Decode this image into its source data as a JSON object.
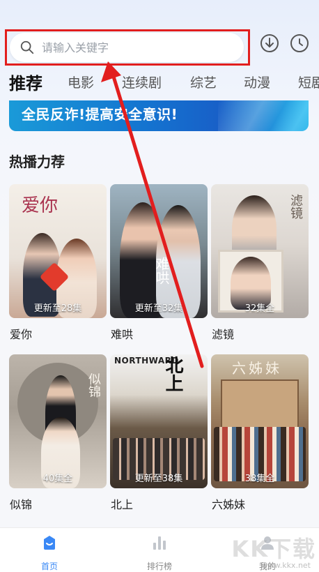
{
  "search": {
    "placeholder": "请输入关键字"
  },
  "header_icons": [
    "download-icon",
    "history-icon"
  ],
  "tabs": [
    {
      "label": "推荐",
      "active": true
    },
    {
      "label": "电影",
      "active": false
    },
    {
      "label": "连续剧",
      "active": false
    },
    {
      "label": "综艺",
      "active": false
    },
    {
      "label": "动漫",
      "active": false
    },
    {
      "label": "短剧",
      "active": false
    }
  ],
  "banner": {
    "text": "全民反诈!提高安全意识!"
  },
  "section": {
    "title": "热播力荐"
  },
  "cards": [
    {
      "title": "爱你",
      "badge": "更新至28集",
      "poster_text": "爱你"
    },
    {
      "title": "难哄",
      "badge": "更新至32集",
      "poster_text": "难哄"
    },
    {
      "title": "滤镜",
      "badge": "32集全",
      "poster_text": "滤镜"
    },
    {
      "title": "似锦",
      "badge": "40集全",
      "poster_text": "似锦"
    },
    {
      "title": "北上",
      "badge": "更新至38集",
      "poster_text": "北上",
      "poster_subtext": "NORTHWARD"
    },
    {
      "title": "六姊妹",
      "badge": "38集全",
      "poster_text": "六姊妹"
    }
  ],
  "bottom_nav": [
    {
      "label": "首页",
      "icon": "home-icon",
      "active": true
    },
    {
      "label": "排行榜",
      "icon": "ranking-icon",
      "active": false
    },
    {
      "label": "我的",
      "icon": "profile-icon",
      "active": false
    }
  ],
  "watermark": {
    "text": "KK下载",
    "sub": "www.kkx.net"
  },
  "colors": {
    "accent": "#3a88f5",
    "highlight_box": "#e21e1e",
    "banner": "#1474d0"
  }
}
